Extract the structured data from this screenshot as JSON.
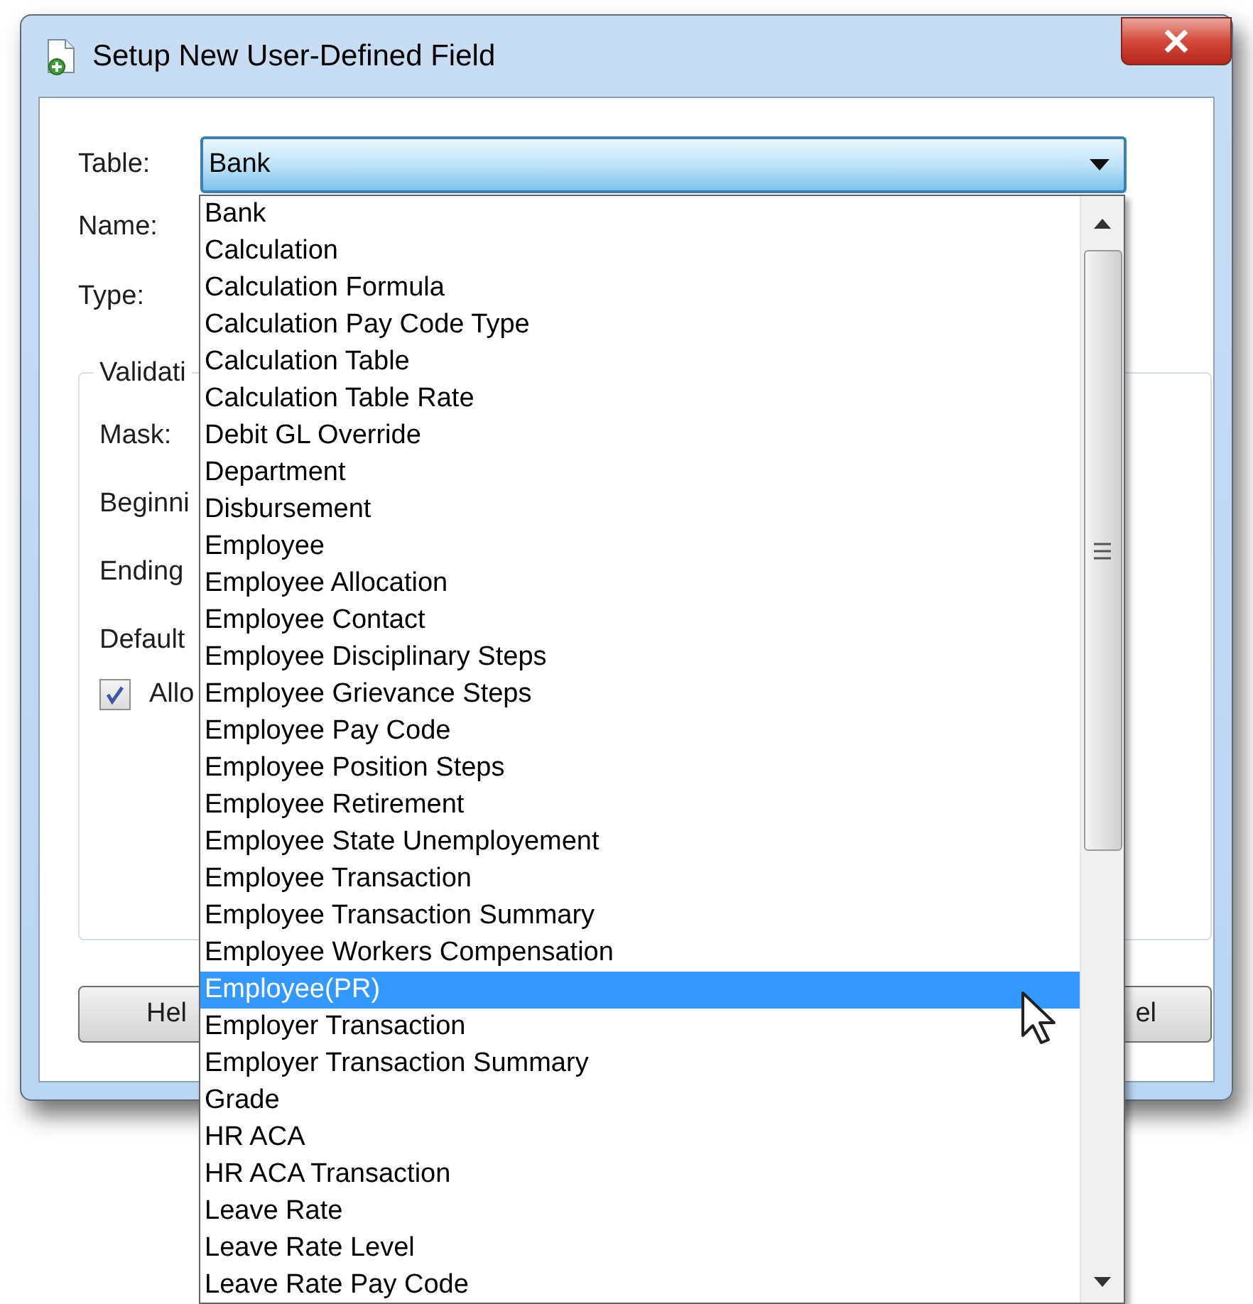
{
  "window": {
    "title": "Setup New User-Defined Field"
  },
  "form": {
    "table_label": "Table:",
    "table_value": "Bank",
    "labels": [
      "Name:",
      "Type:"
    ],
    "group": {
      "legend": "Validati",
      "labels": [
        "Mask:",
        "Beginni",
        "Ending",
        "Default"
      ],
      "checkbox": {
        "label": "Allo",
        "checked": true
      }
    },
    "buttons": [
      "Hel",
      "el"
    ]
  },
  "dropdown": {
    "items": [
      {
        "label": "Bank",
        "selected": false
      },
      {
        "label": "Calculation",
        "selected": false
      },
      {
        "label": "Calculation Formula",
        "selected": false
      },
      {
        "label": "Calculation Pay Code Type",
        "selected": false
      },
      {
        "label": "Calculation Table",
        "selected": false
      },
      {
        "label": "Calculation Table Rate",
        "selected": false
      },
      {
        "label": "Debit GL Override",
        "selected": false
      },
      {
        "label": "Department",
        "selected": false
      },
      {
        "label": "Disbursement",
        "selected": false
      },
      {
        "label": "Employee",
        "selected": false
      },
      {
        "label": "Employee Allocation",
        "selected": false
      },
      {
        "label": "Employee Contact",
        "selected": false
      },
      {
        "label": "Employee Disciplinary Steps",
        "selected": false
      },
      {
        "label": "Employee Grievance Steps",
        "selected": false
      },
      {
        "label": "Employee Pay Code",
        "selected": false
      },
      {
        "label": "Employee Position Steps",
        "selected": false
      },
      {
        "label": "Employee Retirement",
        "selected": false
      },
      {
        "label": "Employee State Unemployement",
        "selected": false
      },
      {
        "label": "Employee Transaction",
        "selected": false
      },
      {
        "label": "Employee Transaction Summary",
        "selected": false
      },
      {
        "label": "Employee Workers Compensation",
        "selected": false
      },
      {
        "label": "Employee(PR)",
        "selected": true
      },
      {
        "label": "Employer Transaction",
        "selected": false
      },
      {
        "label": "Employer Transaction Summary",
        "selected": false
      },
      {
        "label": "Grade",
        "selected": false
      },
      {
        "label": "HR ACA",
        "selected": false
      },
      {
        "label": "HR ACA Transaction",
        "selected": false
      },
      {
        "label": "Leave Rate",
        "selected": false
      },
      {
        "label": "Leave Rate Level",
        "selected": false
      },
      {
        "label": "Leave Rate Pay Code",
        "selected": false
      }
    ]
  }
}
